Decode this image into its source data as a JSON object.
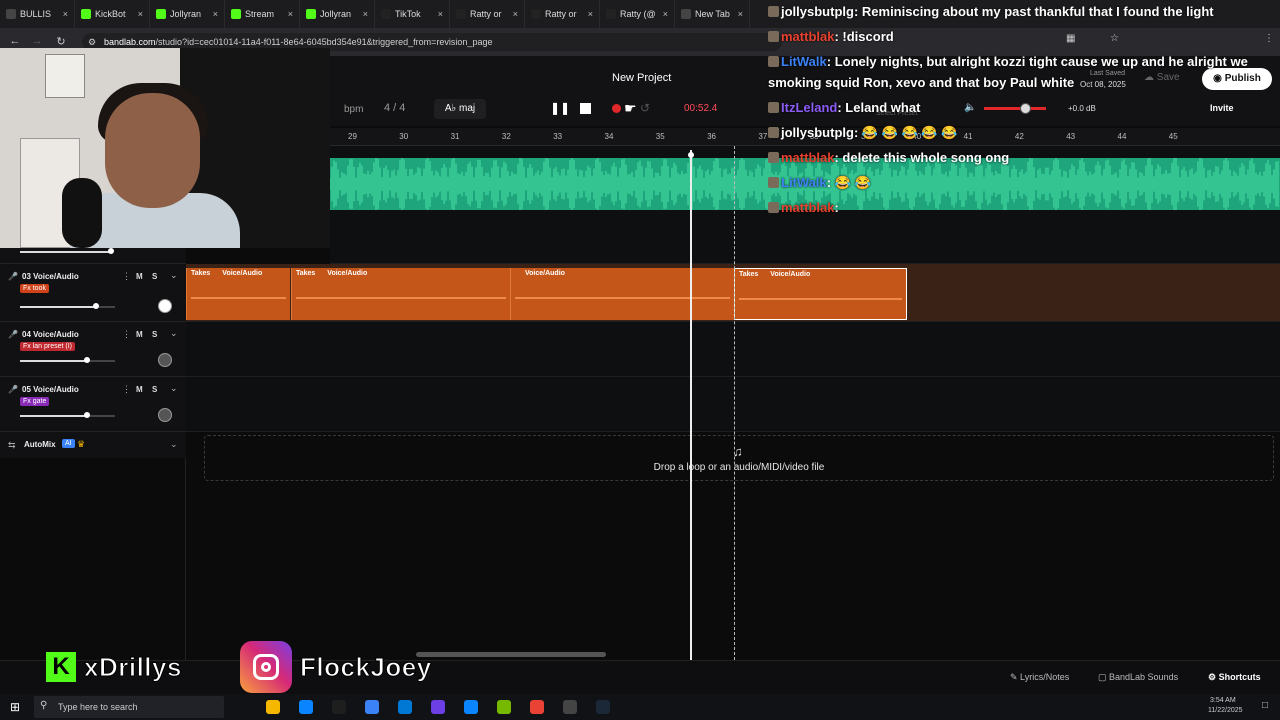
{
  "browser": {
    "tabs": [
      {
        "label": "BULLIS",
        "icon_color": "#444"
      },
      {
        "label": "KickBot",
        "icon_color": "#53fc18"
      },
      {
        "label": "Jollyran",
        "icon_color": "#53fc18"
      },
      {
        "label": "Stream",
        "icon_color": "#53fc18"
      },
      {
        "label": "Jollyran",
        "icon_color": "#53fc18"
      },
      {
        "label": "TikTok",
        "icon_color": "#222"
      },
      {
        "label": "Ratty or",
        "icon_color": "#222"
      },
      {
        "label": "Ratty or",
        "icon_color": "#222"
      },
      {
        "label": "Ratty (@",
        "icon_color": "#222"
      },
      {
        "label": "New Tab",
        "icon_color": "#444"
      }
    ],
    "url_host": "bandlab.com",
    "url_path": "/studio?id=cec01014-11a4-f011-8e64-6045bd354e91&triggered_from=revision_page"
  },
  "studio": {
    "project_title": "New Project",
    "bpm": "bpm",
    "time_sig": "4 / 4",
    "key": "A♭ maj",
    "time": "00:52.4",
    "last_saved_label": "Last Saved",
    "last_saved_date": "Oct 08, 2025",
    "save_label": "Save",
    "publish_label": "Publish",
    "invite_label": "Invite",
    "master_volume": "+0.0 dB",
    "select_preset": "Select Preset"
  },
  "ruler": [
    "29",
    "30",
    "31",
    "32",
    "33",
    "34",
    "35",
    "36",
    "37",
    "38",
    "39",
    "40",
    "41",
    "42",
    "43",
    "44",
    "45"
  ],
  "tracks": [
    {
      "name": "03 Voice/Audio",
      "fx": "Fx took",
      "fx_color": "#d0421a",
      "volume": 0.8
    },
    {
      "name": "04 Voice/Audio",
      "fx": "Fx lan preset (I)",
      "fx_color": "#c0282f",
      "volume": 0.7
    },
    {
      "name": "05 Voice/Audio",
      "fx": "Fx gate",
      "fx_color": "#8a2bb8",
      "volume": 0.7
    }
  ],
  "mute_label": "M",
  "solo_label": "S",
  "clips": [
    {
      "title": "Takes",
      "sub": "Voice/Audio"
    },
    {
      "title": "Takes",
      "sub": "Voice/Audio"
    },
    {
      "title": "",
      "sub": "Voice/Audio"
    },
    {
      "title": "Takes",
      "sub": "Voice/Audio"
    }
  ],
  "automix_label": "AutoMix",
  "automix_ai": "AI",
  "drop_text": "Drop a loop or an audio/MIDI/video file",
  "footer": {
    "lyrics": "Lyrics/Notes",
    "sounds": "BandLab Sounds",
    "shortcuts": "Shortcuts"
  },
  "chat": [
    {
      "user": "jollysbutplg",
      "user_color": "#ffffff",
      "msg": ": Reminiscing about my past thankful that I found the light"
    },
    {
      "user": "mattblak",
      "user_color": "#e8412e",
      "msg": ": !discord"
    },
    {
      "user": "LitWalk",
      "user_color": "#3b82f6",
      "msg": ": Lonely nights, but alright kozzi tight cause we up and he alright we"
    },
    {
      "user": "",
      "user_color": "#ffffff",
      "msg": "smoking squid Ron, xevo and that boy Paul white"
    },
    {
      "user": "ItzLeland",
      "user_color": "#8b5cf6",
      "msg": ": Leland what"
    },
    {
      "user": "jollysbutplg",
      "user_color": "#ffffff",
      "msg": ": 😂 😂 😂 😂 😂"
    },
    {
      "user": "mattblak",
      "user_color": "#e8412e",
      "msg": ": delete this whole song ong"
    },
    {
      "user": "LitWalk",
      "user_color": "#3b82f6",
      "msg": ": 😂 😂"
    },
    {
      "user": "mattblak",
      "user_color": "#e8412e",
      "msg": ":"
    }
  ],
  "overlay": {
    "kick_handle": "xDrillys",
    "ig_handle": "FlockJoey",
    "kick_color": "#53fc18"
  },
  "taskbar": {
    "search_placeholder": "Type here to search",
    "clock_time": "3:54 AM",
    "clock_date": "11/22/2025"
  }
}
